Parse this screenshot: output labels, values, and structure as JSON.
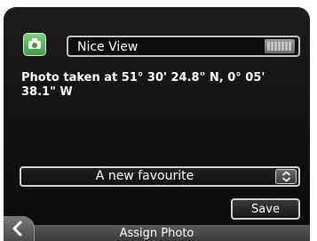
{
  "location": {
    "name_value": "Nice View",
    "info_text": "Photo taken at 51° 30' 24.8\" N, 0° 05' 38.1\" W"
  },
  "favourite_select": {
    "selected": "A new favourite"
  },
  "actions": {
    "save_label": "Save"
  },
  "footer": {
    "title": "Assign Photo"
  },
  "icons": {
    "photo": "camera-icon",
    "keyboard": "keyboard-icon",
    "select_arrows": "up-down-arrows-icon",
    "back": "chevron-left-icon"
  },
  "colors": {
    "background": "#111111",
    "accent_green": "#3d9b3d",
    "text": "#ffffff",
    "border": "#cfcfcf"
  }
}
